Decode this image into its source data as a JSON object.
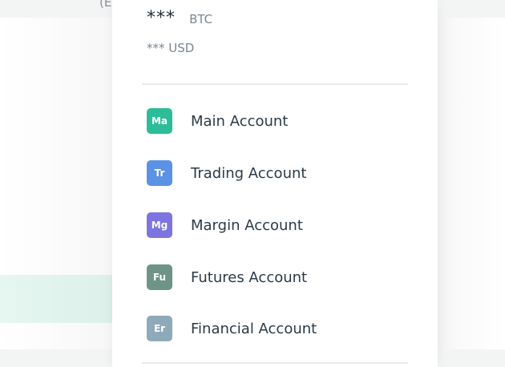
{
  "background": {
    "topbar_text": "(E"
  },
  "balance": {
    "amount": "***",
    "currency": "BTC",
    "usd": "*** USD"
  },
  "accounts": [
    {
      "abbr": "Ma",
      "label": "Main Account",
      "color": "#2dbc98"
    },
    {
      "abbr": "Tr",
      "label": "Trading Account",
      "color": "#5b92e5"
    },
    {
      "abbr": "Mg",
      "label": "Margin Account",
      "color": "#7e74df"
    },
    {
      "abbr": "Fu",
      "label": "Futures Account",
      "color": "#6e9487"
    },
    {
      "abbr": "Er",
      "label": "Financial Account",
      "color": "#8eaab8"
    }
  ]
}
